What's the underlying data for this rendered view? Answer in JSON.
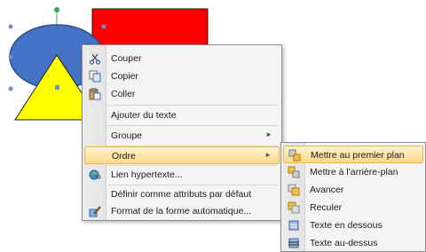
{
  "colors": {
    "rectangle": "#ff0000",
    "ellipse": "#4472c4",
    "triangle": "#ffff00",
    "highlight": "#fbd989"
  },
  "main_menu": {
    "items": [
      {
        "label": "Couper",
        "icon": "scissors-icon"
      },
      {
        "label": "Copier",
        "icon": "copy-icon"
      },
      {
        "label": "Coller",
        "icon": "paste-icon"
      },
      {
        "label": "Ajouter du texte",
        "icon": ""
      },
      {
        "label": "Groupe",
        "icon": "",
        "submenu": true
      },
      {
        "label": "Ordre",
        "icon": "",
        "submenu": true,
        "highlighted": true
      },
      {
        "label": "Lien hypertexte...",
        "icon": "hyperlink-icon"
      },
      {
        "label": "Définir comme attributs par défaut",
        "icon": ""
      },
      {
        "label": "Format de la forme automatique...",
        "icon": "format-shape-icon"
      }
    ],
    "arrow_glyph": "►"
  },
  "sub_menu": {
    "items": [
      {
        "label": "Mettre au premier plan",
        "icon": "bring-to-front-icon",
        "highlighted": true
      },
      {
        "label": "Mettre à l'arrière-plan",
        "icon": "send-to-back-icon"
      },
      {
        "label": "Avancer",
        "icon": "bring-forward-icon"
      },
      {
        "label": "Reculer",
        "icon": "send-backward-icon"
      },
      {
        "label": "Texte en dessous",
        "icon": "text-below-icon"
      },
      {
        "label": "Texte au-dessus",
        "icon": "text-above-icon"
      }
    ]
  }
}
